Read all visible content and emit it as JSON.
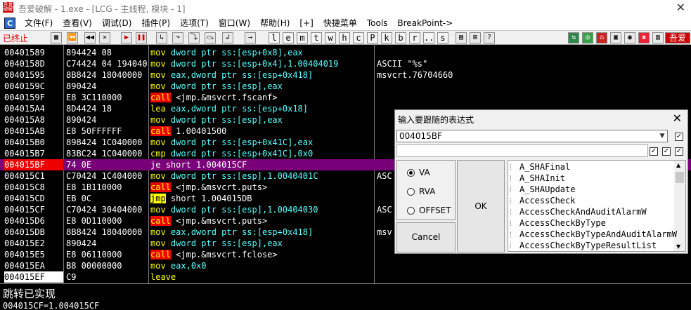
{
  "window": {
    "title": "吾爱破解 - 1.exe - [LCG - 主线程, 模块 - 1]",
    "close_glyph": "✕"
  },
  "menu": [
    "文件(F)",
    "查看(V)",
    "调试(D)",
    "插件(P)",
    "选项(T)",
    "窗口(W)",
    "帮助(H)",
    "[+]",
    "快捷菜单",
    "Tools",
    "BreakPoint->"
  ],
  "toolbar": {
    "status": "已终止",
    "letters": [
      "l",
      "e",
      "m",
      "t",
      "w",
      "h",
      "c",
      "P",
      "k",
      "b",
      "r",
      "...",
      "s"
    ],
    "right_label": "吾爱"
  },
  "disasm": [
    {
      "addr": "00401589",
      "hex": "894424 08",
      "mn": "mov",
      "ops": "dword ptr ss:[esp+0x8],eax",
      "cmt": ""
    },
    {
      "addr": "0040158D",
      "hex": "C74424 04 19404000",
      "mn": "mov",
      "ops": "dword ptr ss:[esp+0x4],1.00404019",
      "cmt": "ASCII \"%s\""
    },
    {
      "addr": "00401595",
      "hex": "8B8424 18040000",
      "mn": "mov",
      "ops": "eax,dword ptr ss:[esp+0x418]",
      "cmt": "msvcrt.76704660"
    },
    {
      "addr": "0040159C",
      "hex": "890424",
      "mn": "mov",
      "ops": "dword ptr ss:[esp],eax",
      "cmt": ""
    },
    {
      "addr": "0040159F",
      "hex": "E8 3C110000",
      "mn": "call",
      "ops": "<jmp.&msvcrt.fscanf>",
      "cmt": ""
    },
    {
      "addr": "004015A4",
      "hex": "8D4424 18",
      "mn": "lea",
      "ops": "eax,dword ptr ss:[esp+0x18]",
      "cmt": ""
    },
    {
      "addr": "004015A8",
      "hex": "890424",
      "mn": "mov",
      "ops": "dword ptr ss:[esp],eax",
      "cmt": ""
    },
    {
      "addr": "004015AB",
      "hex": "E8 50FFFFFF",
      "mn": "call",
      "ops": "1.00401500",
      "cmt": ""
    },
    {
      "addr": "004015B0",
      "hex": "898424 1C040000",
      "mn": "mov",
      "ops": "dword ptr ss:[esp+0x41C],eax",
      "cmt": ""
    },
    {
      "addr": "004015B7",
      "hex": "83BC24 1C040000 00",
      "mn": "cmp",
      "ops": "dword ptr ss:[esp+0x41C],0x0",
      "cmt": ""
    },
    {
      "addr": "004015BF",
      "hex": "74 0E",
      "mn": "je",
      "ops": "short 1.004015CF",
      "cmt": ""
    },
    {
      "addr": "004015C1",
      "hex": "C70424 1C404000",
      "mn": "mov",
      "ops": "dword ptr ss:[esp],1.0040401C",
      "cmt": "ASC"
    },
    {
      "addr": "004015C8",
      "hex": "E8 1B110000",
      "mn": "call",
      "ops": "<jmp.&msvcrt.puts>",
      "cmt": ""
    },
    {
      "addr": "004015CD",
      "hex": "EB 0C",
      "mn": "jmp",
      "ops": "short 1.004015DB",
      "cmt": ""
    },
    {
      "addr": "004015CF",
      "hex": "C70424 30404000",
      "mn": "mov",
      "ops": "dword ptr ss:[esp],1.00404030",
      "cmt": "ASC"
    },
    {
      "addr": "004015D6",
      "hex": "E8 0D110000",
      "mn": "call",
      "ops": "<jmp.&msvcrt.puts>",
      "cmt": ""
    },
    {
      "addr": "004015DB",
      "hex": "8B8424 18040000",
      "mn": "mov",
      "ops": "eax,dword ptr ss:[esp+0x418]",
      "cmt": "msv"
    },
    {
      "addr": "004015E2",
      "hex": "890424",
      "mn": "mov",
      "ops": "dword ptr ss:[esp],eax",
      "cmt": ""
    },
    {
      "addr": "004015E5",
      "hex": "E8 06110000",
      "mn": "call",
      "ops": "<jmp.&msvcrt.fclose>",
      "cmt": ""
    },
    {
      "addr": "004015EA",
      "hex": "B8 00000000",
      "mn": "mov",
      "ops": "eax,0x0",
      "cmt": ""
    },
    {
      "addr": "004015EF",
      "hex": "C9",
      "mn": "leave",
      "ops": "",
      "cmt": ""
    }
  ],
  "dialog": {
    "title": "输入要跟随的表达式",
    "close_glyph": "✕",
    "expression": "004015BF",
    "radios": [
      {
        "label": "VA",
        "checked": true
      },
      {
        "label": "RVA",
        "checked": false
      },
      {
        "label": "OFFSET",
        "checked": false
      }
    ],
    "ok_label": "OK",
    "cancel_label": "Cancel",
    "symbols": [
      "A_SHAFinal",
      "A_SHAInit",
      "A_SHAUpdate",
      "AccessCheck",
      "AccessCheckAndAuditAlarmW",
      "AccessCheckByType",
      "AccessCheckByTypeAndAuditAlarmW",
      "AccessCheckByTypeResultList"
    ]
  },
  "status": {
    "message": "跳转已实现",
    "expression": "004015CF=1.004015CF"
  }
}
